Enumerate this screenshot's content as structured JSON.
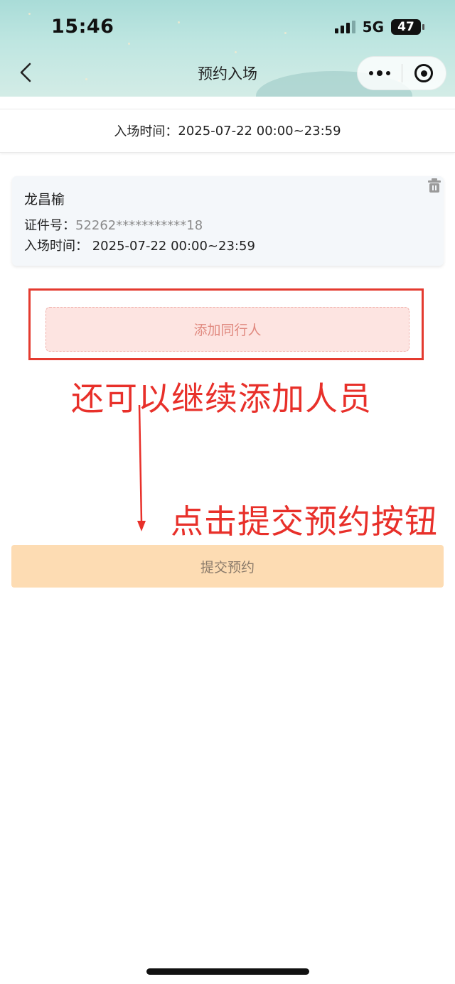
{
  "status_bar": {
    "time": "15:46",
    "network": "5G",
    "battery": "47"
  },
  "nav": {
    "title": "预约入场"
  },
  "banner": {
    "label": "入场时间：",
    "value": "2025-07-22 00:00~23:59"
  },
  "person": {
    "name": "龙昌榆",
    "id_label": "证件号：",
    "id_value": "52262***********18",
    "time_label": "入场时间：",
    "time_value": "2025-07-22 00:00~23:59"
  },
  "actions": {
    "add_companion": "添加同行人",
    "submit": "提交预约"
  },
  "annotations": {
    "hint_add": "还可以继续添加人员",
    "hint_submit": "点击提交预约按钮"
  },
  "colors": {
    "annotation": "#e8302a",
    "add_button_bg": "#fde4e1",
    "submit_button_bg": "#fddcb3",
    "card_bg": "#f4f7fa"
  }
}
